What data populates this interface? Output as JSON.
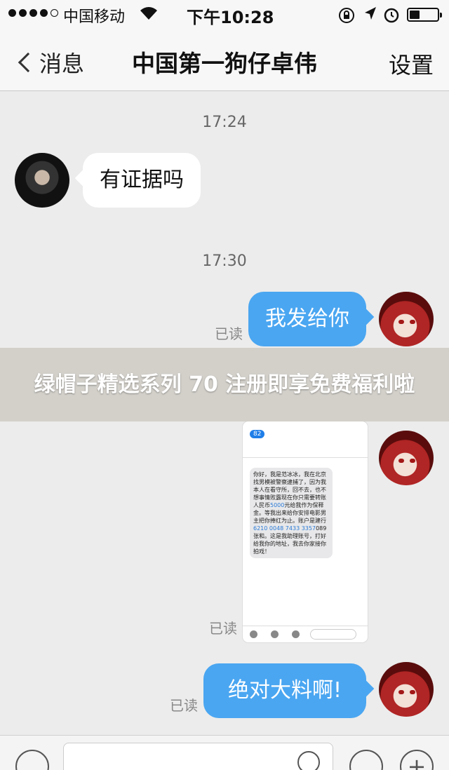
{
  "status_bar": {
    "carrier": "中国移动",
    "time": "下午10:28",
    "battery_level": 0.35,
    "icons": [
      "signal-dots-icon",
      "wifi-icon",
      "orientation-lock-icon",
      "location-arrow-icon",
      "alarm-icon",
      "battery-icon"
    ]
  },
  "nav": {
    "back_label": "消息",
    "title": "中国第一狗仔卓伟",
    "settings_label": "设置"
  },
  "messages": {
    "ts1": "17:24",
    "m1_text": "有证据吗",
    "ts2": "17:30",
    "m2_text": "我发给你",
    "m2_read": "已读",
    "m3_read": "已读",
    "m4_text": "绝对大料啊!",
    "m4_read": "已读"
  },
  "screenshot": {
    "badge": "82",
    "sms_text": "你好，我是范冰冰，我在北京找男模被警察逮捕了，因为我本人在看守所，回不去，也不想事情败露现在你只需要转账人民币",
    "amount": "5000",
    "sms_text_2": "元给我作为保释金。等我出来给你安排电影男主把你捧红为止。账户是建行",
    "account": "6210 0048 7433 3357",
    "sms_text_3": "089张和。这是我助理账号，打好给我你的地址，我去你家接你拍戏！"
  },
  "promo": {
    "text": "绿帽子精选系列 70 注册即享免费福利啦"
  },
  "input_bar": {
    "icons": [
      "voice-icon",
      "emoji-icon",
      "clock-icon",
      "plus-icon"
    ]
  }
}
